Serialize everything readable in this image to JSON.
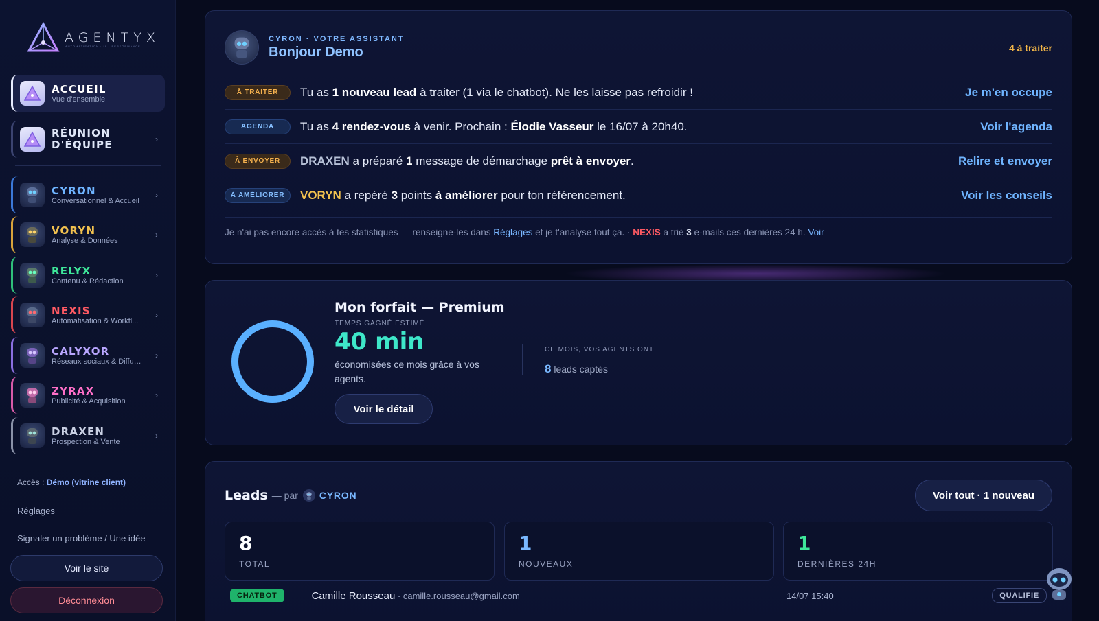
{
  "brand": {
    "name": "AGENTYX",
    "tagline": "AUTOMATISATION · IA · PERFORMANCE"
  },
  "sidebar": {
    "items": [
      {
        "title": "ACCUEIL",
        "sub": "Vue d'ensemble"
      },
      {
        "title": "RÉUNION",
        "title2": "D'ÉQUIPE"
      },
      {
        "title": "CYRON",
        "sub": "Conversationnel & Accueil",
        "color": "#6fb4ff"
      },
      {
        "title": "VORYN",
        "sub": "Analyse & Données",
        "color": "#f1c14f"
      },
      {
        "title": "RELYX",
        "sub": "Contenu & Rédaction",
        "color": "#3ee79a"
      },
      {
        "title": "NEXIS",
        "sub": "Automatisation & Workfl...",
        "color": "#ff5a63"
      },
      {
        "title": "CALYXOR",
        "sub": "Réseaux sociaux & Diffusi...",
        "color": "#b9a6ff"
      },
      {
        "title": "ZYRAX",
        "sub": "Publicité & Acquisition",
        "color": "#ff6fc8"
      },
      {
        "title": "DRAXEN",
        "sub": "Prospection & Vente",
        "color": "#c9d0e3"
      }
    ],
    "access_label": "Accès : ",
    "access_value": "Démo (vitrine client)",
    "settings": "Réglages",
    "report": "Signaler un problème / Une idée",
    "site_button": "Voir le site",
    "logout_button": "Déconnexion"
  },
  "assistant": {
    "kicker": "CYRON · VOTRE ASSISTANT",
    "greeting": "Bonjour Demo",
    "count": "4 à traiter",
    "tasks": [
      {
        "badge": "À TRAITER",
        "p1": "Tu as ",
        "b1": "1 nouveau lead",
        "p2": " à traiter (1 via le chatbot). Ne les laisse pas refroidir !",
        "action": "Je m'en occupe"
      },
      {
        "badge": "AGENDA",
        "p1": "Tu as ",
        "b1": "4 rendez-vous",
        "p2": " à venir. Prochain : ",
        "b2": "Élodie Vasseur",
        "p3": " le 16/07 à 20h40.",
        "action": "Voir l'agenda"
      },
      {
        "badge": "À ENVOYER",
        "agent": "DRAXEN",
        "p1": " a préparé ",
        "b1": "1",
        "p2": " message de démarchage ",
        "b2": "prêt à envoyer",
        "p3": ".",
        "action": "Relire et envoyer"
      },
      {
        "badge": "À AMÉLIORER",
        "agent": "VORYN",
        "p1": " a repéré ",
        "b1": "3",
        "p2": " points ",
        "b2": "à améliorer",
        "p3": " pour ton référencement.",
        "action": "Voir les conseils"
      }
    ],
    "note": {
      "p1": "Je n'ai pas encore accès à tes statistiques — renseigne-les dans ",
      "link1": "Réglages",
      "p2": " et je t'analyse tout ça. · ",
      "agent": "NEXIS",
      "p3": " a trié ",
      "n": "3",
      "p4": " e-mails ces dernières 24 h. ",
      "link2": "Voir"
    }
  },
  "plan": {
    "title": "Mon forfait — Premium",
    "kicker": "TEMPS GAGNÉ ESTIMÉ",
    "value": "40 min",
    "desc": "économisées ce mois grâce à vos agents.",
    "button": "Voir le détail",
    "month_kicker": "CE MOIS, VOS AGENTS ONT",
    "month_n": "8",
    "month_text": " leads captés"
  },
  "leads": {
    "title": "Leads",
    "by": "— par",
    "agent": "CYRON",
    "button": "Voir tout · 1 nouveau",
    "kpis": [
      {
        "value": "8",
        "label": "TOTAL",
        "color": "#ffffff"
      },
      {
        "value": "1",
        "label": "NOUVEAUX",
        "color": "#7ab8ff"
      },
      {
        "value": "1",
        "label": "DERNIÈRES 24H",
        "color": "#3ee79a"
      }
    ],
    "row": {
      "source": "CHATBOT",
      "name": "Camille Rousseau",
      "email": " · camille.rousseau@gmail.com",
      "date": "14/07 15:40",
      "status": "QUALIFIE"
    }
  }
}
